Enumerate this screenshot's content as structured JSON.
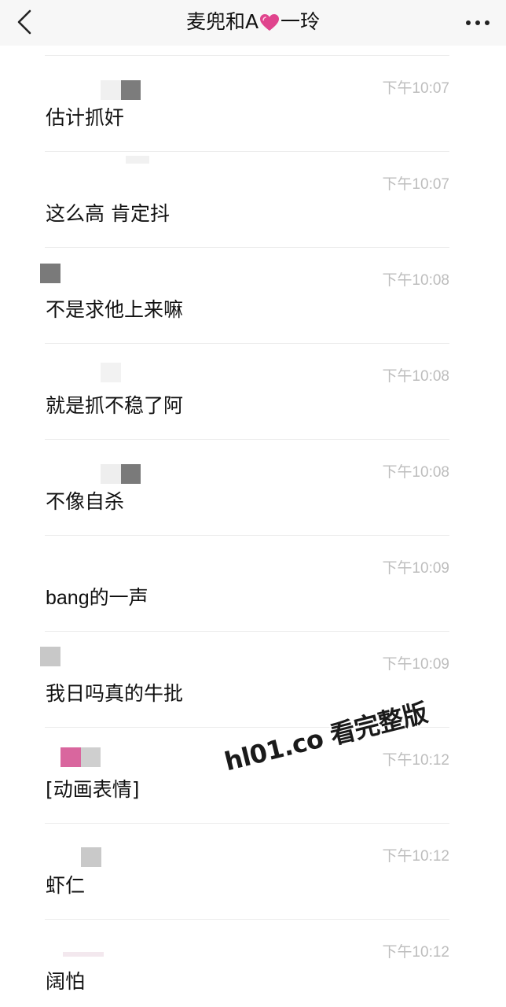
{
  "header": {
    "title_prefix": "麦兜和A",
    "title_suffix": "一玲",
    "heart_color": "#e0448d"
  },
  "messages": [
    {
      "text": "估计抓奸",
      "time": "下午10:07"
    },
    {
      "text": "这么高 肯定抖",
      "time": "下午10:07"
    },
    {
      "text": "不是求他上来嘛",
      "time": "下午10:08"
    },
    {
      "text": "就是抓不稳了阿",
      "time": "下午10:08"
    },
    {
      "text": "不像自杀",
      "time": "下午10:08"
    },
    {
      "text": "bang的一声",
      "time": "下午10:09"
    },
    {
      "text": "我日吗真的牛批",
      "time": "下午10:09"
    },
    {
      "text": "[动画表情]",
      "time": "下午10:12"
    },
    {
      "text": "虾仁",
      "time": "下午10:12"
    },
    {
      "text": "阔怕",
      "time": "下午10:12"
    }
  ],
  "watermark": {
    "text": "hl01.co 看完整版"
  },
  "icons": {
    "back": "chevron-left-icon",
    "more": "more-dots-icon",
    "heart": "heart-icon"
  }
}
